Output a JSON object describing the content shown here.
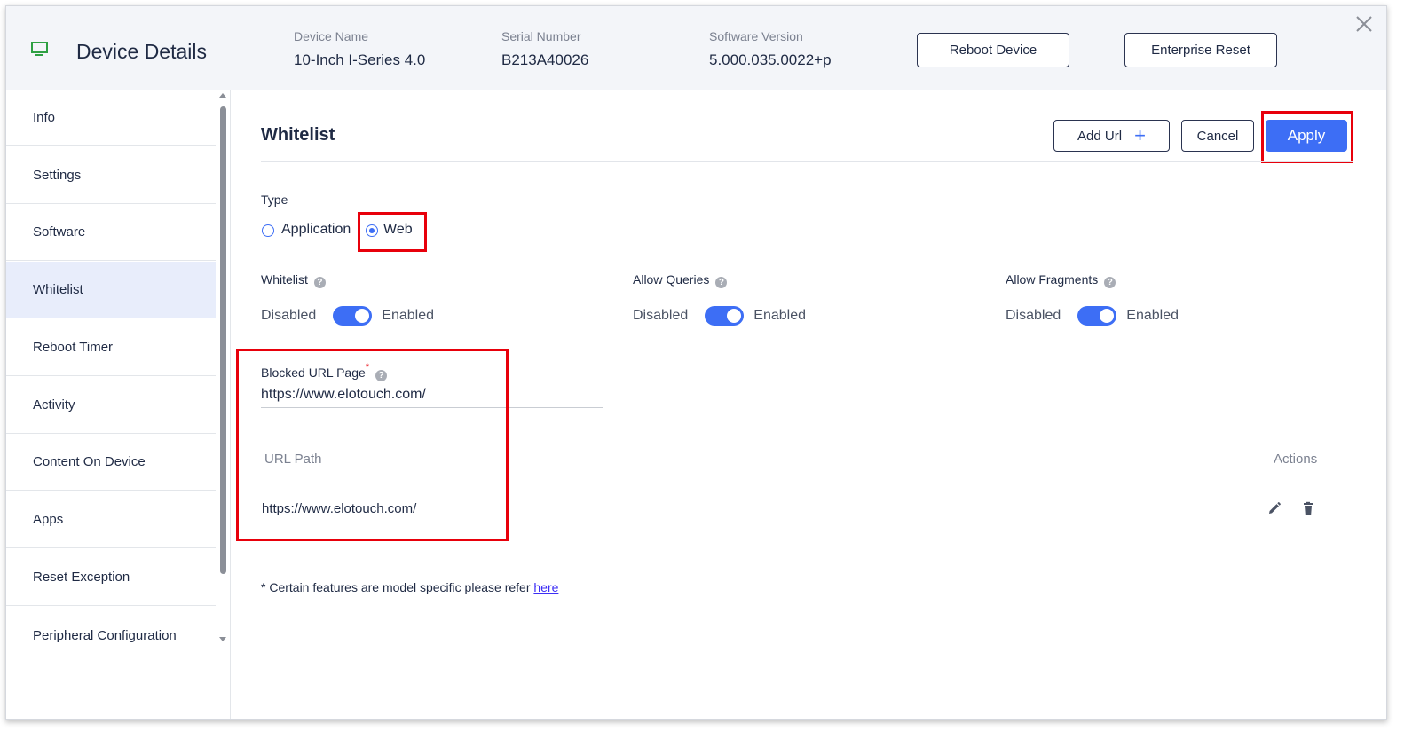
{
  "header": {
    "title": "Device Details",
    "device_name_label": "Device Name",
    "device_name": "10-Inch I-Series 4.0",
    "serial_label": "Serial Number",
    "serial": "B213A40026",
    "software_label": "Software Version",
    "software_version": "5.000.035.0022+p",
    "reboot_label": "Reboot Device",
    "reset_label": "Enterprise Reset"
  },
  "sidebar": {
    "items": [
      {
        "label": "Info"
      },
      {
        "label": "Settings"
      },
      {
        "label": "Software"
      },
      {
        "label": "Whitelist"
      },
      {
        "label": "Reboot Timer"
      },
      {
        "label": "Activity"
      },
      {
        "label": "Content On Device"
      },
      {
        "label": "Apps"
      },
      {
        "label": "Reset Exception"
      },
      {
        "label": "Peripheral Configuration"
      }
    ],
    "active": "Whitelist"
  },
  "main": {
    "title": "Whitelist",
    "add_url_label": "Add Url",
    "add_url_icon": "+",
    "cancel_label": "Cancel",
    "apply_label": "Apply",
    "type_label": "Type",
    "type_options": [
      {
        "label": "Application",
        "checked": false
      },
      {
        "label": "Web",
        "checked": true
      }
    ],
    "toggles": [
      {
        "label": "Whitelist",
        "off": "Disabled",
        "on": "Enabled",
        "enabled": true
      },
      {
        "label": "Allow Queries",
        "off": "Disabled",
        "on": "Enabled",
        "enabled": true
      },
      {
        "label": "Allow Fragments",
        "off": "Disabled",
        "on": "Enabled",
        "enabled": true
      }
    ],
    "help_icon": "?",
    "blocked_label": "Blocked URL Page",
    "required_mark": "*",
    "blocked_value": "https://www.elotouch.com/",
    "table": {
      "columns": [
        "URL Path",
        "Actions"
      ],
      "rows": [
        {
          "url": "https://www.elotouch.com/"
        }
      ]
    },
    "footnote": "* Certain features are model specific please refer",
    "footnote_link": "here"
  },
  "colors": {
    "accent": "#3d6ef5",
    "highlight": "#e8000b",
    "header_bg": "#f3f5f9",
    "active_bg": "#e8edfb"
  }
}
